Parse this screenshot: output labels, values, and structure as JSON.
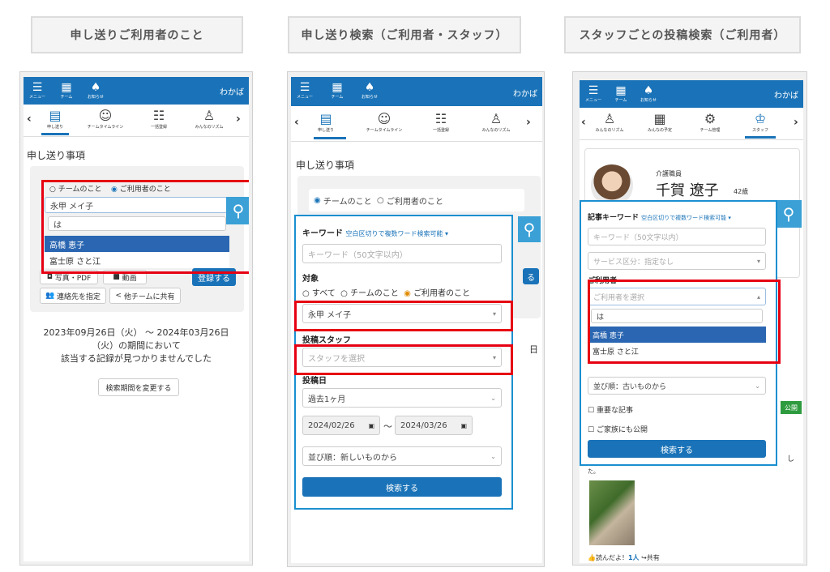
{
  "headers": [
    "申し送りご利用者のこと",
    "申し送り検索（ご利用者・スタッフ）",
    "スタッフごとの投稿検索（ご利用者）"
  ],
  "topbar": {
    "menu": "メニュー",
    "team": "チーム",
    "notify": "お知らせ",
    "user": "わかば"
  },
  "p1": {
    "nav": [
      "申し送り",
      "チームタイムライン",
      "一括登録",
      "みんなのリズム"
    ],
    "title": "申し送り事項",
    "radio_team": "チームのこと",
    "radio_user": "ご利用者のこと",
    "select_value": "永甲 メイ子",
    "search_text": "は",
    "options": [
      "高橋 恵子",
      "富士原 さと江"
    ],
    "btn_photo": "写真・PDF",
    "btn_video": "動画",
    "btn_register": "登録する",
    "btn_contact": "連絡先を指定",
    "btn_share": "他チームに共有",
    "period_line1": "2023年09月26日（火） ～ 2024年03月26日",
    "period_line2": "（火）の期間において",
    "period_line3": "該当する記録が見つかりませんでした",
    "btn_change": "検索期間を変更する"
  },
  "p2": {
    "nav": [
      "申し送り",
      "チームタイムライン",
      "一括登録",
      "みんなのリズム"
    ],
    "title": "申し送り事項",
    "radio_team": "チームのこと",
    "radio_user": "ご利用者のこと",
    "kw_label": "キーワード",
    "kw_hint": "空白区切りで複数ワード検索可能",
    "kw_placeholder": "キーワード（50文字以内）",
    "target_label": "対象",
    "t_all": "すべて",
    "t_team": "チームのこと",
    "t_user": "ご利用者のこと",
    "user_value": "永甲 メイ子",
    "staff_label": "投稿スタッフ",
    "staff_placeholder": "スタッフを選択",
    "date_label": "投稿日",
    "range": "過去1ヶ月",
    "date_from": "2024/02/26",
    "date_to": "2024/03/26",
    "sort": "並び順：新しいものから",
    "btn_search": "検索する",
    "peek_text": "日",
    "peek_btn": "る"
  },
  "p3": {
    "nav": [
      "みんなのリズム",
      "みんなの予定",
      "チーム管理",
      "スタッフ"
    ],
    "role": "介護職員",
    "name": "千賀 遼子",
    "age": "42歳",
    "kw_label": "記事キーワード",
    "kw_hint": "空白区切りで複数ワード検索可能",
    "kw_placeholder": "キーワード（50文字以内）",
    "service_placeholder": "サービス区分：指定なし",
    "user_label": "ご利用者",
    "user_placeholder": "ご利用者を選択",
    "search_text": "は",
    "options": [
      "高橋 恵子",
      "富士原 さと江"
    ],
    "sort": "並び順：古いものから",
    "chk_important": "重要な記事",
    "chk_family": "ご家族にも公開",
    "btn_search": "検索する",
    "badge": "公開",
    "like": "読んだよ！",
    "like_count": "1人",
    "share": "共有",
    "peek_a": "し",
    "peek_b": "た。"
  }
}
